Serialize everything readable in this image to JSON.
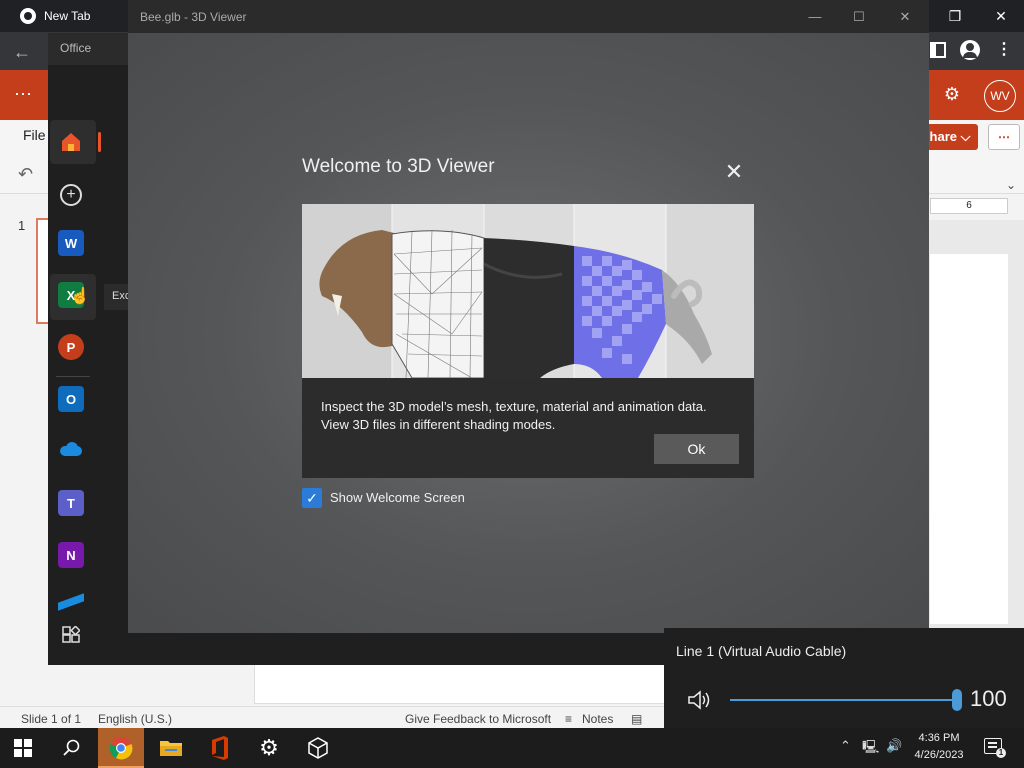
{
  "chrome": {
    "tab_title": "New Tab",
    "minimize": "—",
    "restore": "❐",
    "close": "✕"
  },
  "office": {
    "launcher_title": "Office",
    "file_tab": "File",
    "share_label": "hare ⌵",
    "more_label": "⋯",
    "avatar_initials": "WV",
    "ruler_label": "6",
    "excel_tooltip": "Exc",
    "slide_number": "1",
    "colors": {
      "brand": "#c43e1c",
      "launcher_bg": "#1f1f1f"
    }
  },
  "statusbar": {
    "slide_info": "Slide 1 of 1",
    "language": "English (U.S.)",
    "feedback": "Give Feedback to Microsoft",
    "notes": "Notes"
  },
  "viewer": {
    "window_title": "Bee.glb - 3D Viewer",
    "dialog_title": "Welcome to 3D Viewer",
    "dialog_text_1": "Inspect the 3D model’s mesh, texture, material and animation data.",
    "dialog_text_2": "View 3D files in different shading modes.",
    "ok_label": "Ok",
    "show_welcome_label": "Show Welcome Screen",
    "show_welcome_checked": true
  },
  "volume": {
    "device_name": "Line 1 (Virtual Audio Cable)",
    "level": 100,
    "level_text": "100"
  },
  "taskbar": {
    "time": "4:36 PM",
    "date": "4/26/2023",
    "pinned": [
      "start-icon",
      "search-icon",
      "chrome-icon",
      "file-explorer-icon",
      "office-icon",
      "settings-icon",
      "3d-viewer-icon"
    ]
  }
}
